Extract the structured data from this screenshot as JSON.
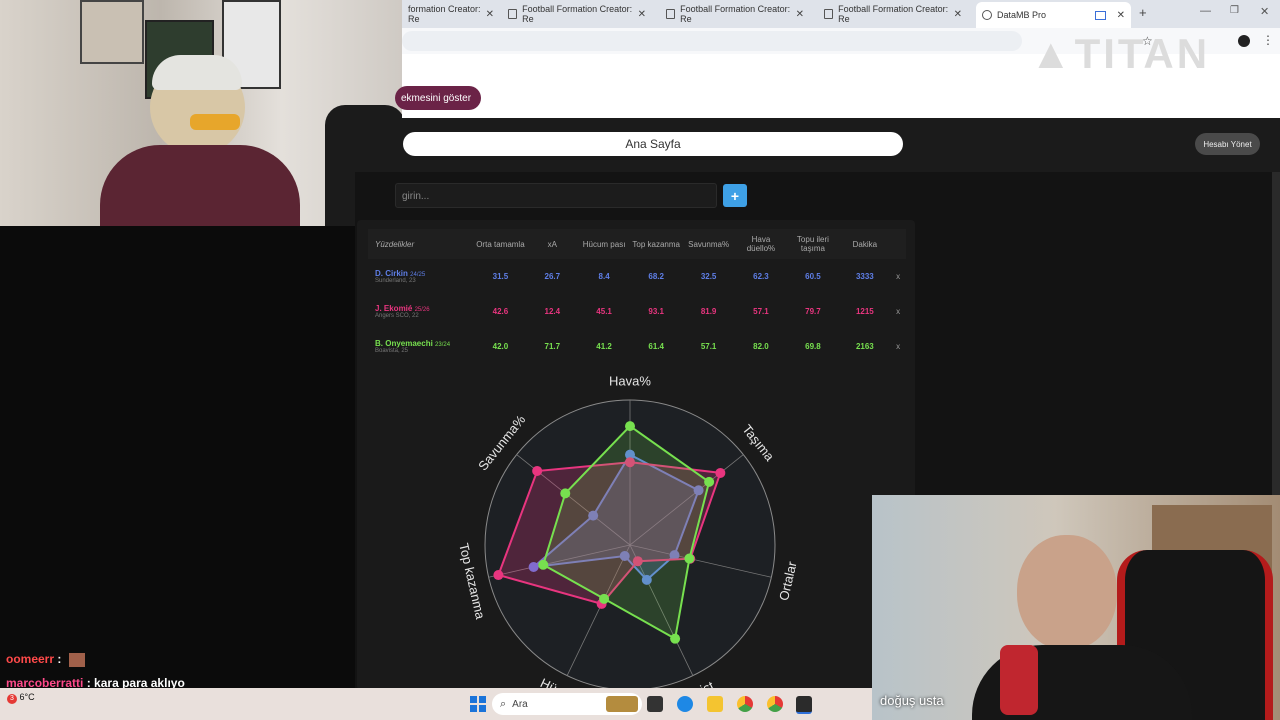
{
  "browser": {
    "tabs": [
      {
        "label": "formation Creator: Re",
        "active": false
      },
      {
        "label": "Football Formation Creator: Re",
        "active": false
      },
      {
        "label": "Football Formation Creator: Re",
        "active": false
      },
      {
        "label": "Football Formation Creator: Re",
        "active": false
      },
      {
        "label": "DataMB Pro",
        "active": true
      }
    ],
    "show_tabs_label": "ekmesini göster"
  },
  "app": {
    "home_label": "Ana Sayfa",
    "account_label": "Hesabı Yönet",
    "search_placeholder": "girin...",
    "add_label": "+"
  },
  "table": {
    "corner_label": "Yüzdelikler",
    "columns": [
      "Orta tamamla",
      "xA",
      "Hücum pası",
      "Top kazanma",
      "Savunma%",
      "Hava düello%",
      "Topu ileri taşıma",
      "Dakika"
    ],
    "rows": [
      {
        "name": "D. Cirkin",
        "season": "24/25",
        "club": "Sunderland, 23",
        "color": "#5f7fe8",
        "values": [
          "31.5",
          "26.7",
          "8.4",
          "68.2",
          "32.5",
          "62.3",
          "60.5",
          "3333"
        ],
        "remove": "x"
      },
      {
        "name": "J. Ekomié",
        "season": "25/26",
        "club": "Angers SCO, 22",
        "color": "#e8357f",
        "values": [
          "42.6",
          "12.4",
          "45.1",
          "93.1",
          "81.9",
          "57.1",
          "79.7",
          "1215"
        ],
        "remove": "x"
      },
      {
        "name": "B. Onyemaechi",
        "season": "23/24",
        "club": "Boavista, 25",
        "color": "#77e04f",
        "values": [
          "42.0",
          "71.7",
          "41.2",
          "61.4",
          "57.1",
          "82.0",
          "69.8",
          "2163"
        ],
        "remove": "x"
      }
    ]
  },
  "chart_data": {
    "type": "radar",
    "axes": [
      "Hava%",
      "Taşıma",
      "Ortalar",
      "Asist",
      "Hücum",
      "Top kazanma",
      "Savunma%"
    ],
    "max": 100,
    "series": [
      {
        "name": "D. Cirkin",
        "color": "#5f7fe8",
        "values": [
          62.3,
          60.5,
          31.5,
          26.7,
          8.4,
          68.2,
          32.5
        ]
      },
      {
        "name": "J. Ekomié",
        "color": "#e8357f",
        "values": [
          57.1,
          79.7,
          42.6,
          12.4,
          45.1,
          93.1,
          81.9
        ]
      },
      {
        "name": "B. Onyemaechi",
        "color": "#77e04f",
        "values": [
          82.0,
          69.8,
          42.0,
          71.7,
          41.2,
          61.4,
          57.1
        ]
      }
    ]
  },
  "chat": [
    {
      "user": "oomeerr",
      "text": ":"
    },
    {
      "user": "marcoberratti",
      "text": ": kara para aklıyo"
    }
  ],
  "stream": {
    "cam_name": "doğuş usta"
  },
  "taskbar": {
    "search_label": "Ara",
    "weather": "6°C",
    "notification_count": "3"
  }
}
